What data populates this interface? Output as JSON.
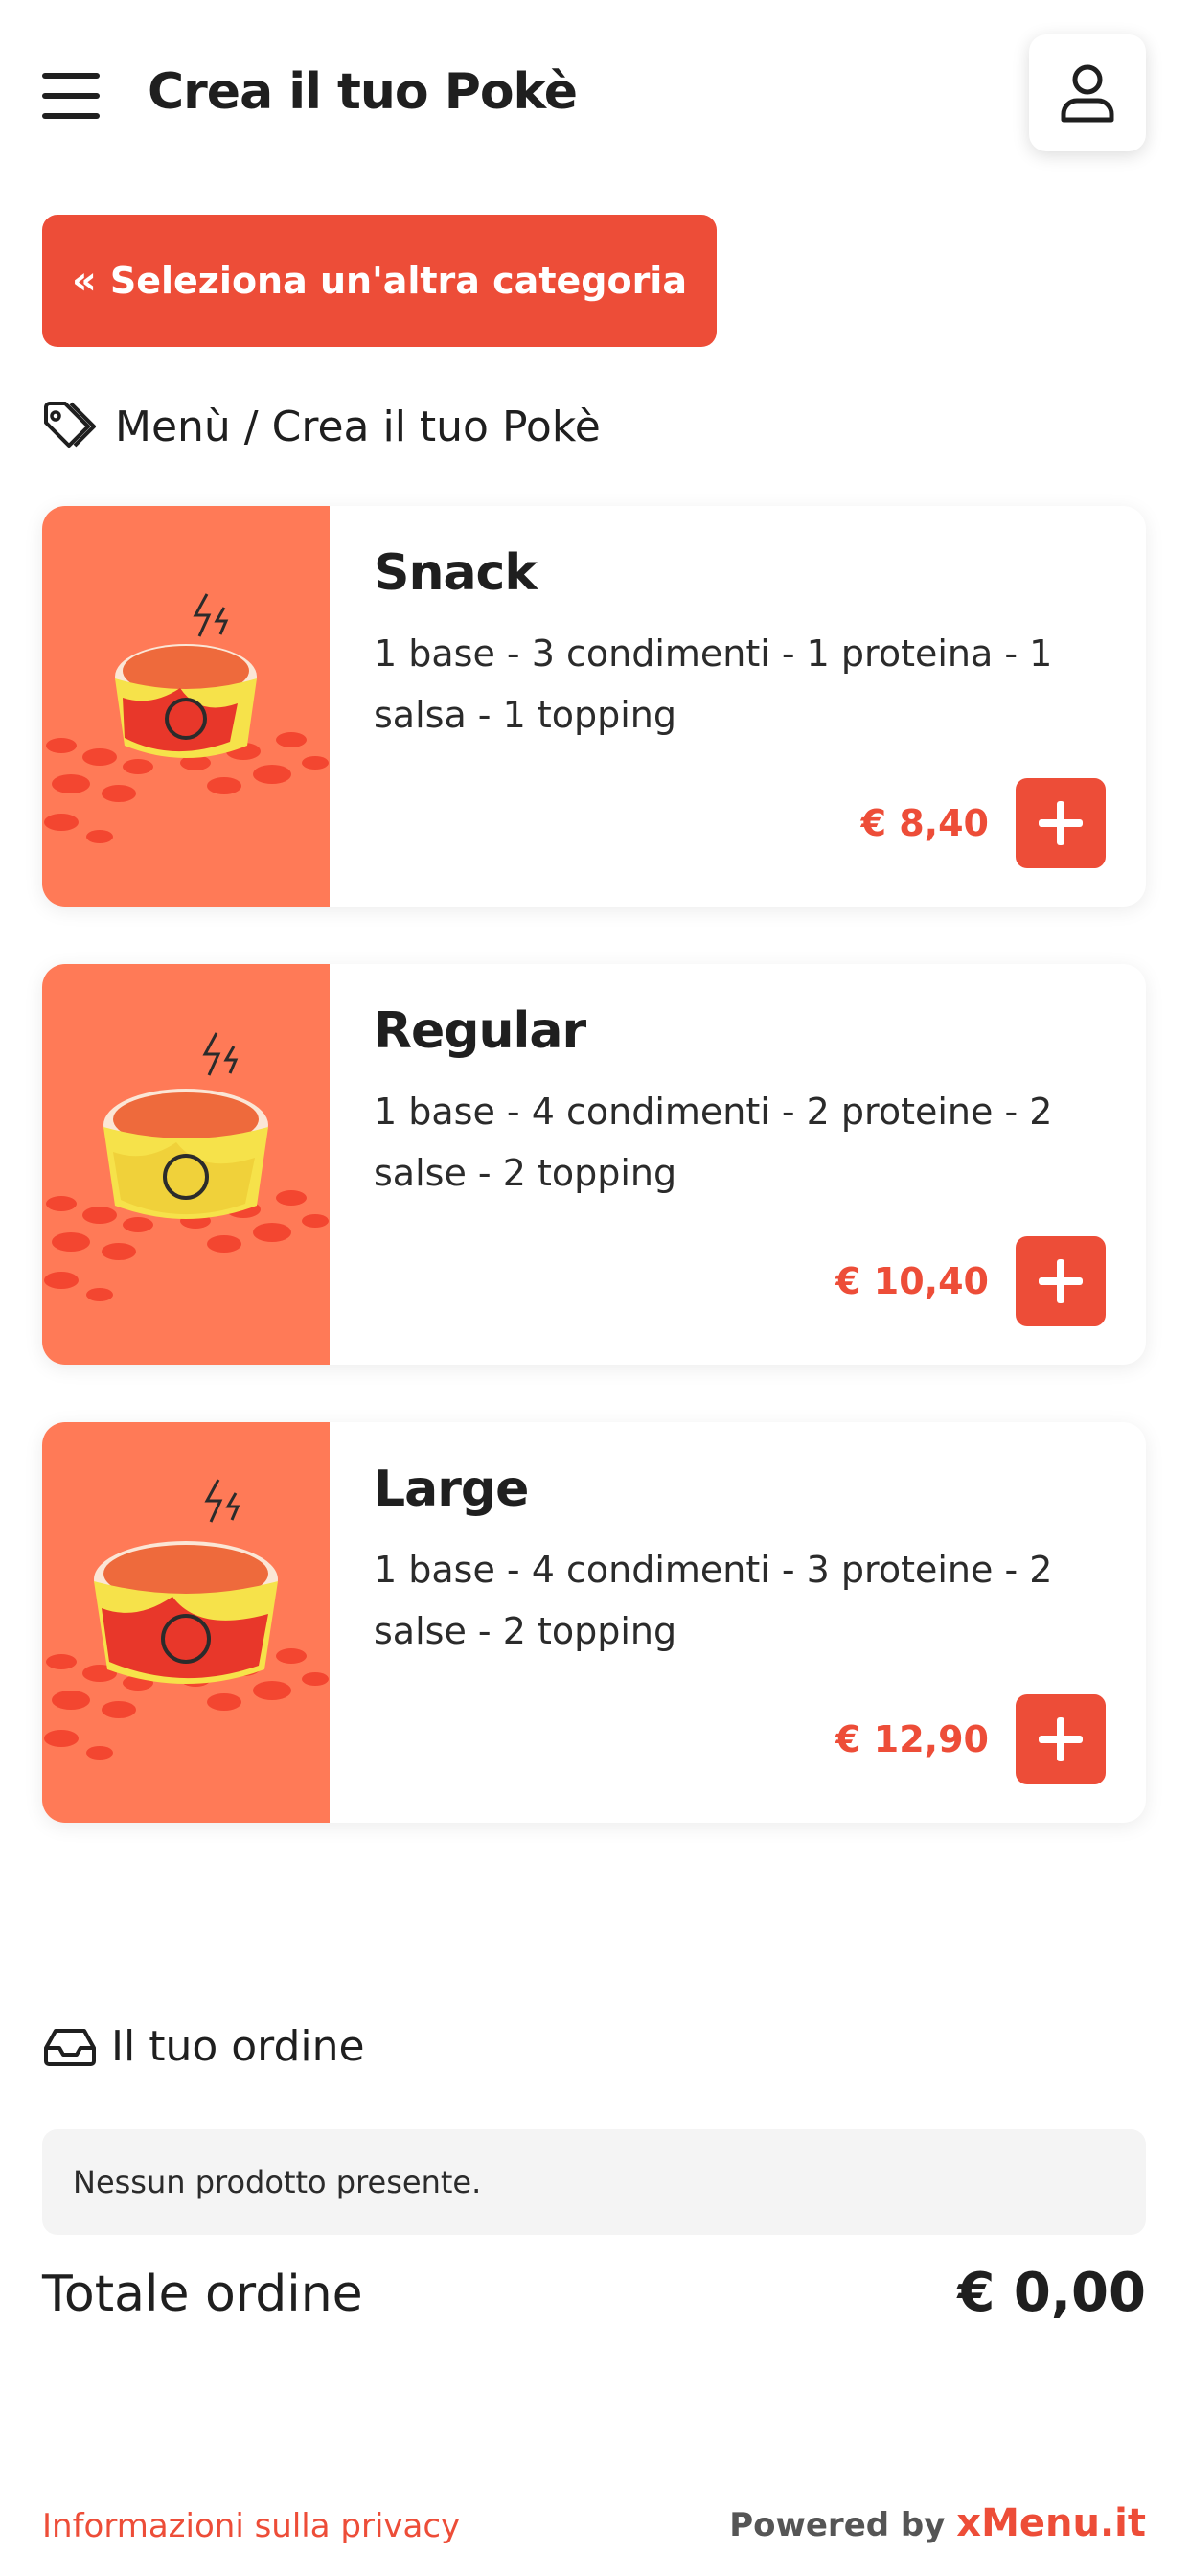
{
  "header": {
    "title": "Crea il tuo Pokè",
    "menu_icon": "hamburger-menu-icon",
    "user_icon": "user-icon"
  },
  "back_button": {
    "label": "Seleziona un'altra categoria",
    "icon": "double-chevron-left-icon"
  },
  "breadcrumb": {
    "icon": "tag-icon",
    "text": "Menù / Crea il tuo Pokè"
  },
  "products": [
    {
      "name": "Snack",
      "description": "1 base - 3 condimenti - 1 proteina - 1 salsa - 1 topping",
      "price": "€ 8,40",
      "image": "poke-bowl-image"
    },
    {
      "name": "Regular",
      "description": "1 base - 4 condimenti - 2 proteine - 2 salse - 2 topping",
      "price": "€ 10,40",
      "image": "poke-bowl-image"
    },
    {
      "name": "Large",
      "description": "1 base - 4 condimenti - 3 proteine - 2 salse - 2 topping",
      "price": "€ 12,90",
      "image": "poke-bowl-image"
    }
  ],
  "order": {
    "icon": "inbox-icon",
    "title": "Il tuo ordine",
    "empty_message": "Nessun prodotto presente.",
    "total_label": "Totale ordine",
    "total_value": "€ 0,00"
  },
  "footer": {
    "privacy_link": "Informazioni sulla privacy",
    "powered_by": "Powered by",
    "brand": "xMenu.it"
  },
  "colors": {
    "accent": "#ed4d38",
    "image_bg": "#ff7a57",
    "text": "#1f1f1f",
    "empty_box_bg": "#f4f4f4"
  }
}
